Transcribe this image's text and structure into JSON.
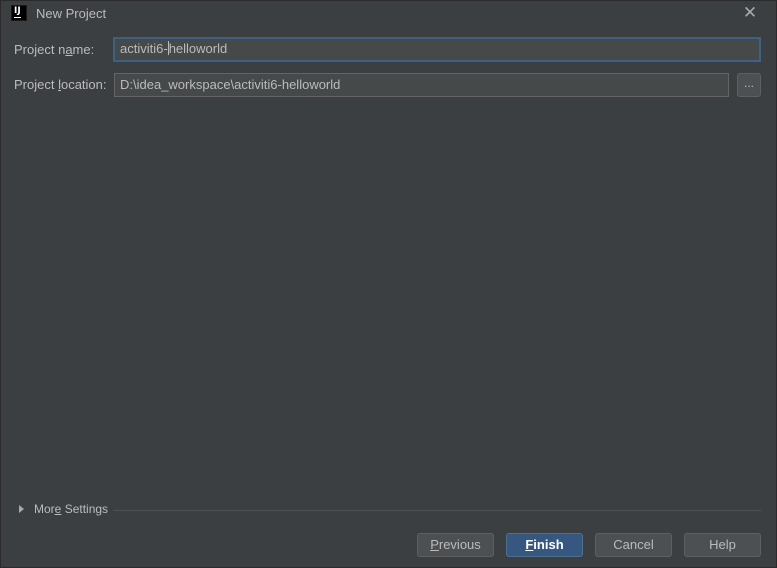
{
  "window": {
    "title": "New Project"
  },
  "form": {
    "name_label_pre": "Project n",
    "name_label_ul": "a",
    "name_label_post": "me:",
    "name_value_pre": "activiti6-",
    "name_value_post": "helloworld",
    "location_label_pre": "Project ",
    "location_label_ul": "l",
    "location_label_post": "ocation:",
    "location_value": "D:\\idea_workspace\\activiti6-helloworld",
    "browse_label": "..."
  },
  "more_settings": {
    "label_pre": "Mor",
    "label_ul": "e",
    "label_post": " Settings"
  },
  "buttons": {
    "previous_ul": "P",
    "previous_rest": "revious",
    "finish_ul": "F",
    "finish_rest": "inish",
    "cancel": "Cancel",
    "help": "Help"
  },
  "colors": {
    "background": "#3c3f41",
    "field_background": "#45494a",
    "focus_border": "#3d6185",
    "default_button": "#365880"
  },
  "icons": {
    "app": "intellij-idea-icon",
    "close": "close-icon",
    "expand": "triangle-right-icon"
  }
}
